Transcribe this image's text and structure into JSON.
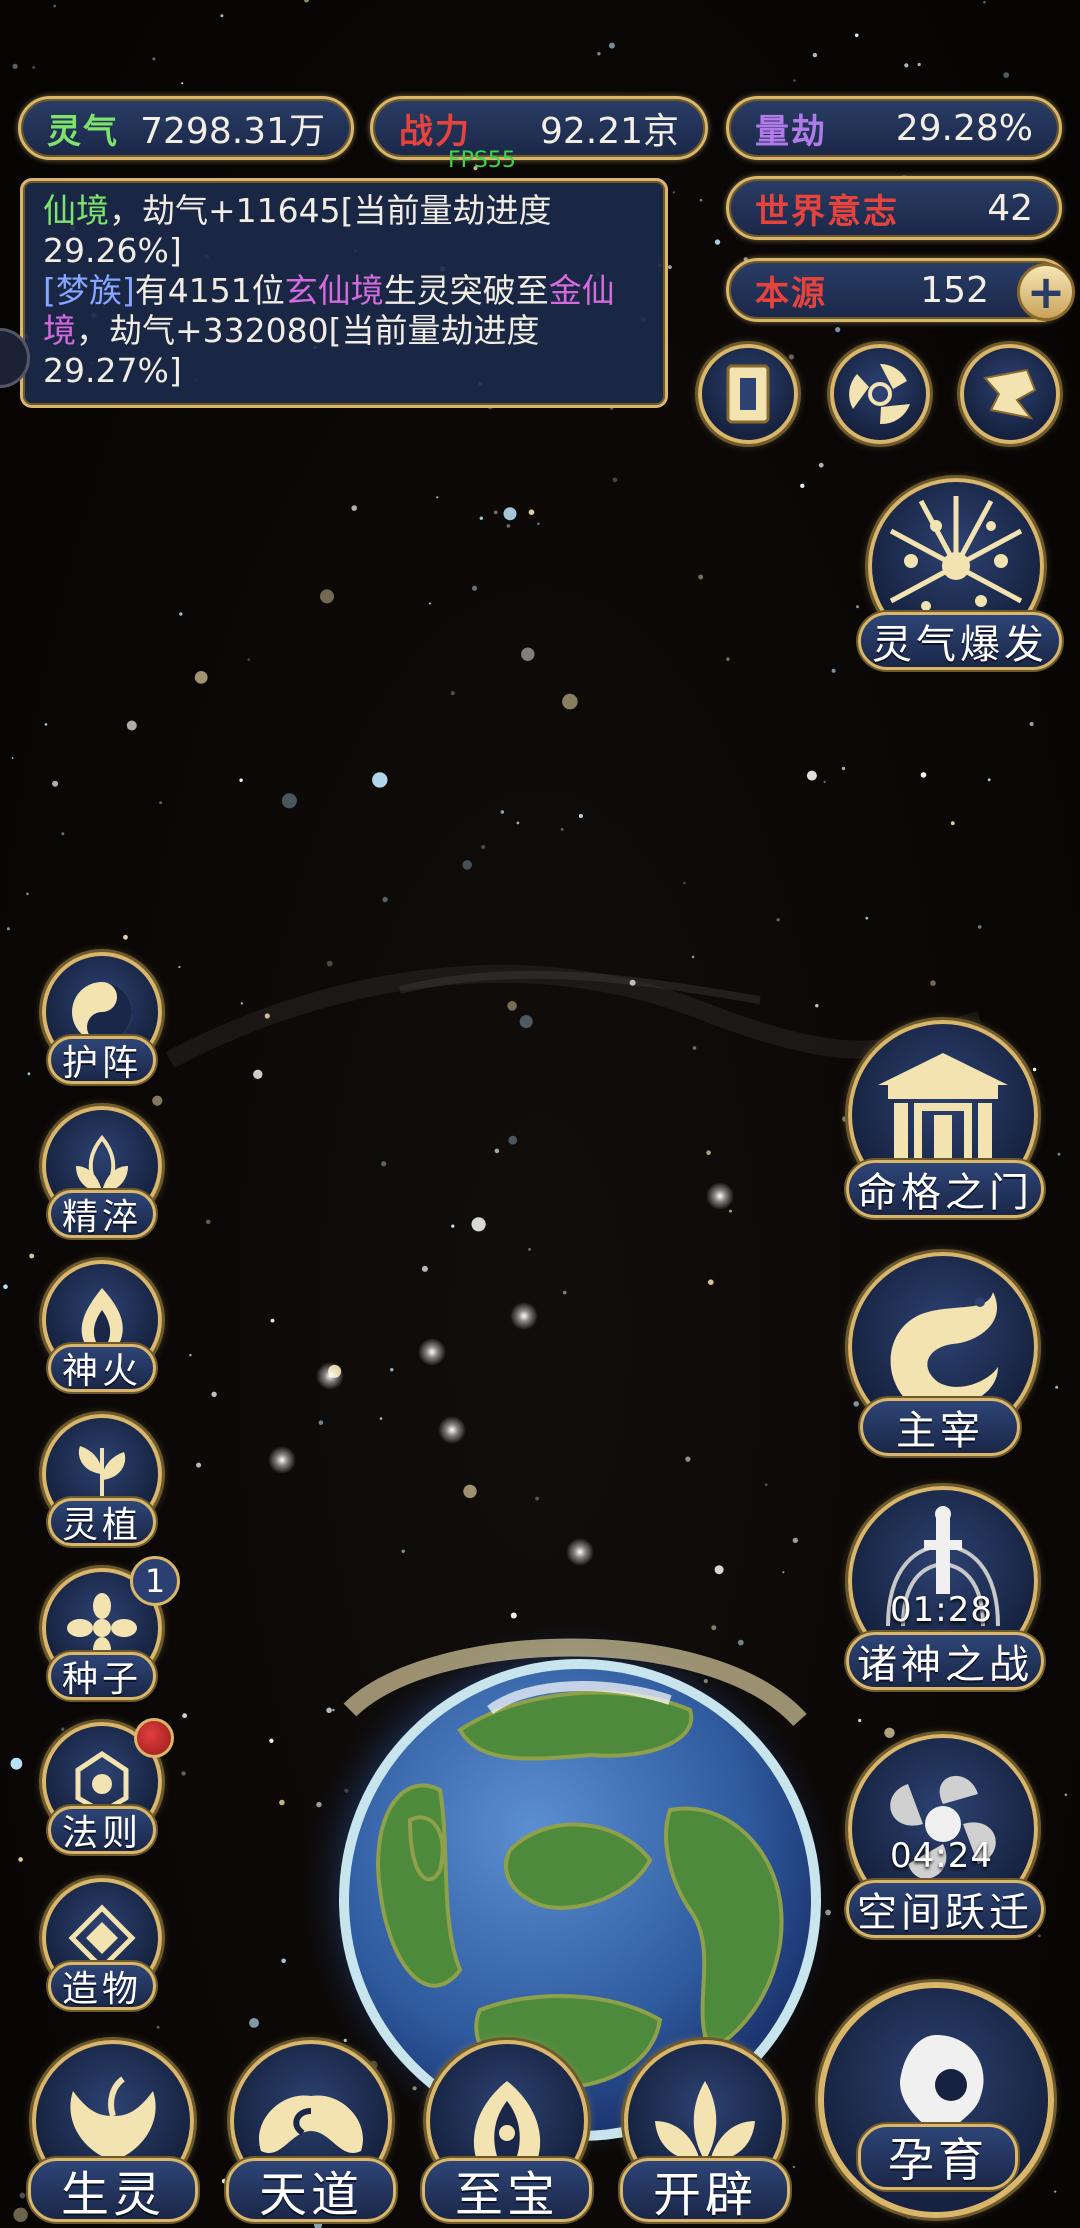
{
  "stats": {
    "lingqi": {
      "label": "灵气",
      "value": "7298.31万",
      "color": "#7ee36b"
    },
    "zhanli": {
      "label": "战力",
      "value": "92.21京",
      "color": "#e7433d"
    },
    "liangjie": {
      "label": "量劫",
      "value": "29.28%",
      "color": "#b07be8"
    },
    "shijie": {
      "label": "世界意志",
      "value": "42",
      "color": "#e7433d"
    },
    "benyuan": {
      "label": "本源",
      "value": "152",
      "color": "#e7433d",
      "plus": "+"
    }
  },
  "fps": "FPS55",
  "log": {
    "line1_realm": "仙境",
    "line1_text": "，劫气+11645[当前量劫进度29.26%]",
    "line2_tribe": "[梦族]",
    "line2_a": "有4151位",
    "line2_realm1": "玄仙境",
    "line2_b": "生灵突破至",
    "line2_realm2": "金仙境",
    "line2_c": "，劫气+332080[当前量劫进度29.27%]"
  },
  "top_icons": [
    {
      "name": "card-icon"
    },
    {
      "name": "swirl-icon"
    },
    {
      "name": "flag-icon"
    }
  ],
  "right_buttons": {
    "burst": "灵气爆发",
    "gate": "命格之门",
    "lord": "主宰",
    "war": {
      "label": "诸神之战",
      "timer": "01:28"
    },
    "leap": {
      "label": "空间跃迁",
      "timer": "04:24"
    },
    "breed": "孕育"
  },
  "left_buttons": [
    {
      "label": "护阵",
      "icon": "yinyang-icon"
    },
    {
      "label": "精淬",
      "icon": "lotus-icon"
    },
    {
      "label": "神火",
      "icon": "flame-icon"
    },
    {
      "label": "灵植",
      "icon": "plant-icon"
    },
    {
      "label": "种子",
      "icon": "seed-icon",
      "badge": "1"
    },
    {
      "label": "法则",
      "icon": "rule-icon",
      "dot": true
    },
    {
      "label": "造物",
      "icon": "creation-icon"
    }
  ],
  "bottom_buttons": [
    {
      "label": "生灵",
      "icon": "phoenix-icon"
    },
    {
      "label": "天道",
      "icon": "cloud-icon"
    },
    {
      "label": "至宝",
      "icon": "treasure-icon"
    },
    {
      "label": "开辟",
      "icon": "lotus-flame-icon"
    }
  ],
  "colors": {
    "gold": "#d9b66a",
    "panel": "#1a2748",
    "accent_blue": "#2d4272"
  }
}
